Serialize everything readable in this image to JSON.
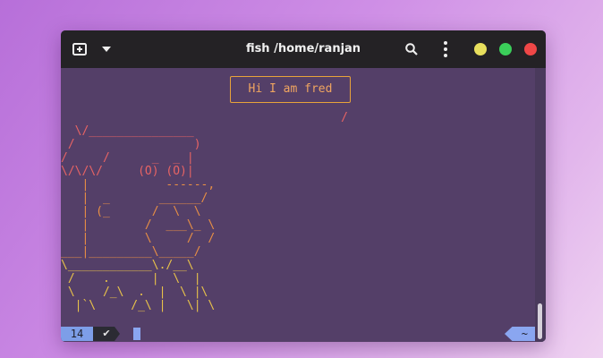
{
  "window": {
    "title": "fish /home/ranjan",
    "controls": [
      "minimize",
      "maximize",
      "close"
    ],
    "colors": {
      "titlebar": "#242225",
      "terminal_bg": "#543f68",
      "min": "#e8df5d",
      "max": "#3bce5a",
      "close": "#ef4747"
    }
  },
  "terminal": {
    "bubble_text": "Hi I am fred",
    "ascii_art": [
      {
        "text": "                                        /",
        "color": "red"
      },
      {
        "text": "  \\/_______________",
        "color": "red"
      },
      {
        "text": " /                 )",
        "color": "red"
      },
      {
        "text": "/     /      _  _ |",
        "color": "red"
      },
      {
        "text": "\\/\\/\\/     (O) (O)|",
        "color": "red"
      },
      {
        "text": "   |           ------,",
        "color": "orange"
      },
      {
        "text": "   |  _       ______/",
        "color": "orange"
      },
      {
        "text": "   | (_      /  \\  \\",
        "color": "orange"
      },
      {
        "text": "   |        /  ___\\_ \\",
        "color": "orange"
      },
      {
        "text": "   |        \\     /  /",
        "color": "orange"
      },
      {
        "text": "___|_________\\_____/",
        "color": "orange"
      },
      {
        "text": "\\____________\\./__\\",
        "color": "yellow"
      },
      {
        "text": " /    .      |  \\  |",
        "color": "yellow"
      },
      {
        "text": " \\    /_\\  .  |  \\ |\\",
        "color": "yellow"
      },
      {
        "text": "  |`\\     /_\\ |   \\| \\",
        "color": "yellow"
      }
    ]
  },
  "statusbar": {
    "line_number": "14",
    "status_icon": "✔",
    "cwd": "~"
  },
  "icons": [
    "new-tab-icon",
    "chevron-down-icon",
    "search-icon",
    "kebab-menu-icon"
  ]
}
